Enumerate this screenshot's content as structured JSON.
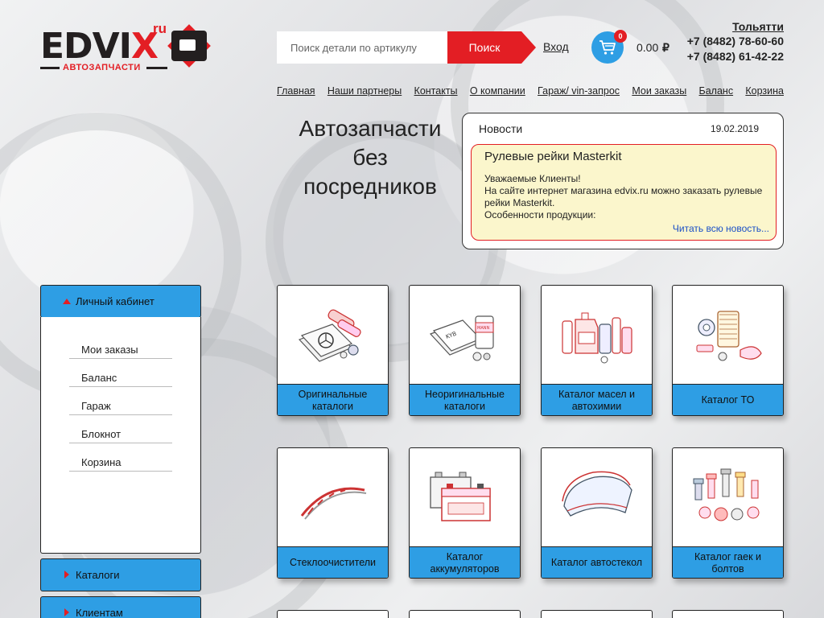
{
  "header": {
    "logo": {
      "word_a": "EDVI",
      "word_b": "X",
      "ru": "ru",
      "subtitle": "АВТОЗАПЧАСТИ"
    },
    "search": {
      "placeholder": "Поиск детали по артикулу",
      "button": "Поиск"
    },
    "login": "Вход",
    "cart": {
      "count": "0",
      "sum": "0.00",
      "currency": "₽"
    },
    "contacts": {
      "city": "Тольятти",
      "phone1": "+7 (8482) 78-60-60",
      "phone2": "+7 (8482) 61-42-22"
    }
  },
  "nav": [
    "Главная",
    "Наши партнеры",
    "Контакты",
    "О компании",
    "Гараж/ vin-запрос",
    "Мои заказы",
    "Баланс",
    "Корзина"
  ],
  "slogan": [
    "Автозапчасти",
    "без",
    "посредников"
  ],
  "news": {
    "title": "Новости",
    "date": "19.02.2019",
    "headline": "Рулевые рейки Masterkit",
    "body": [
      "Уважаемые Клиенты!",
      "На сайте интернет магазина edvix.ru можно заказать рулевые рейки Masterkit.",
      "Особенности продукции:"
    ],
    "more": "Читать всю новость..."
  },
  "sidebar": {
    "cabinet": "Личный кабинет",
    "cabinet_items": [
      "Мои заказы",
      "Баланс",
      "Гараж",
      "Блокнот",
      "Корзина"
    ],
    "catalogs": "Каталоги",
    "clients": "Клиентам"
  },
  "tiles": [
    {
      "label": "Оригинальные каталоги",
      "icon": "original-catalog-icon"
    },
    {
      "label": "Неоригинальные каталоги",
      "icon": "aftermarket-catalog-icon"
    },
    {
      "label": "Каталог масел и автохимии",
      "icon": "oil-chemicals-icon"
    },
    {
      "label": "Каталог ТО",
      "icon": "maintenance-parts-icon"
    },
    {
      "label": "Стеклоочистители",
      "icon": "wiper-blade-icon"
    },
    {
      "label": "Каталог аккумуляторов",
      "icon": "battery-icon"
    },
    {
      "label": "Каталог автостекол",
      "icon": "windshield-icon"
    },
    {
      "label": "Каталог гаек и болтов",
      "icon": "nuts-bolts-icon"
    }
  ],
  "colors": {
    "accent_red": "#e31e24",
    "accent_blue": "#2e9ee4",
    "news_bg": "#fbf6cc"
  }
}
